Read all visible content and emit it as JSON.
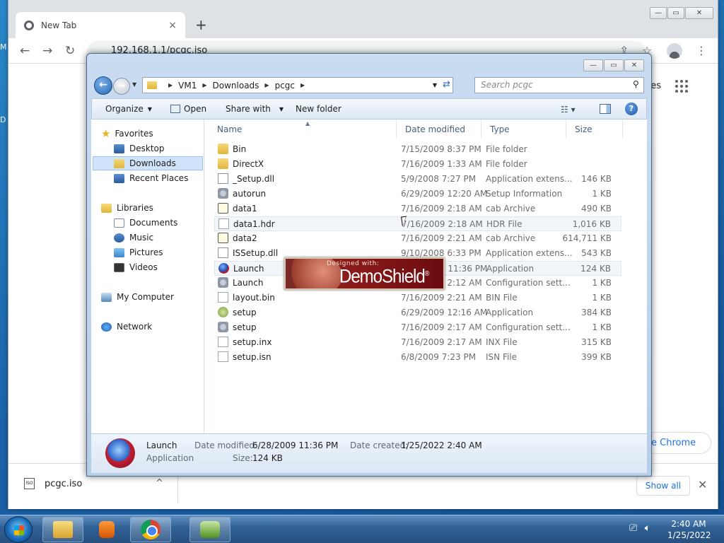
{
  "chrome": {
    "tab_title": "New Tab",
    "tab_close": "×",
    "new_tab": "+",
    "address": "192.168.1.1/pcgc.iso",
    "partial_link": "ges",
    "pill_text": "e Chrome",
    "window_buttons": [
      "—",
      "▭",
      "✕"
    ]
  },
  "download_bar": {
    "file_name": "pcgc.iso",
    "icon_label": "ISO",
    "chevron": "^",
    "show_all": "Show all",
    "close": "✕"
  },
  "desktop_edge": {
    "top": "M",
    "mid": "D"
  },
  "explorer": {
    "window_buttons": [
      "—",
      "▭",
      "✕"
    ],
    "breadcrumb": [
      "VM1",
      "Downloads",
      "pcgc"
    ],
    "search_placeholder": "Search pcgc",
    "toolbar": {
      "organize": "Organize",
      "open": "Open",
      "share_with": "Share with",
      "new_folder": "New folder"
    },
    "nav": {
      "favorites": "Favorites",
      "desktop": "Desktop",
      "downloads": "Downloads",
      "recent_places": "Recent Places",
      "libraries": "Libraries",
      "documents": "Documents",
      "music": "Music",
      "pictures": "Pictures",
      "videos": "Videos",
      "my_computer": "My Computer",
      "network": "Network"
    },
    "columns": {
      "name": "Name",
      "date": "Date modified",
      "type": "Type",
      "size": "Size"
    },
    "files": [
      {
        "name": "Bin",
        "date": "7/15/2009 8:37 PM",
        "type": "File folder",
        "size": "",
        "icon": "folder-icon"
      },
      {
        "name": "DirectX",
        "date": "7/16/2009 1:33 AM",
        "type": "File folder",
        "size": "",
        "icon": "folder-icon"
      },
      {
        "name": "_Setup.dll",
        "date": "5/9/2008 7:27 PM",
        "type": "Application extens...",
        "size": "146 KB",
        "icon": "dll-icon"
      },
      {
        "name": "autorun",
        "date": "6/29/2009 12:20 AM",
        "type": "Setup Information",
        "size": "1 KB",
        "icon": "settings-file-icon"
      },
      {
        "name": "data1",
        "date": "7/16/2009 2:18 AM",
        "type": "cab Archive",
        "size": "490 KB",
        "icon": "cab-icon"
      },
      {
        "name": "data1.hdr",
        "date": "7/16/2009 2:18 AM",
        "type": "HDR File",
        "size": "1,016 KB",
        "icon": "file-icon"
      },
      {
        "name": "data2",
        "date": "7/16/2009 2:21 AM",
        "type": "cab Archive",
        "size": "614,711 KB",
        "icon": "cab-icon"
      },
      {
        "name": "ISSetup.dll",
        "date": "9/10/2008 6:33 PM",
        "type": "Application extens...",
        "size": "543 KB",
        "icon": "dll-icon"
      },
      {
        "name": "Launch",
        "date": "6/28/2009 11:36 PM",
        "type": "Application",
        "size": "124 KB",
        "icon": "launch-app-icon"
      },
      {
        "name": "Launch",
        "date": "7/16/2009 2:12 AM",
        "type": "Configuration sett...",
        "size": "1 KB",
        "icon": "settings-file-icon"
      },
      {
        "name": "layout.bin",
        "date": "7/16/2009 2:21 AM",
        "type": "BIN File",
        "size": "1 KB",
        "icon": "file-icon"
      },
      {
        "name": "setup",
        "date": "6/29/2009 12:16 AM",
        "type": "Application",
        "size": "384 KB",
        "icon": "setup-app-icon"
      },
      {
        "name": "setup",
        "date": "7/16/2009 2:17 AM",
        "type": "Configuration sett...",
        "size": "1 KB",
        "icon": "settings-file-icon"
      },
      {
        "name": "setup.inx",
        "date": "7/16/2009 2:17 AM",
        "type": "INX File",
        "size": "315 KB",
        "icon": "file-icon"
      },
      {
        "name": "setup.isn",
        "date": "6/8/2009 7:23 PM",
        "type": "ISN File",
        "size": "399 KB",
        "icon": "file-icon"
      }
    ],
    "details": {
      "name": "Launch",
      "type": "Application",
      "date_modified_label": "Date modified:",
      "date_modified": "6/28/2009 11:36 PM",
      "size_label": "Size:",
      "size": "124 KB",
      "date_created_label": "Date created:",
      "date_created": "1/25/2022 2:40 AM"
    }
  },
  "splash": {
    "designed_with": "Designed with:",
    "brand": "DemoShield",
    "trademark": "®"
  },
  "taskbar": {
    "time": "2:40 AM",
    "date": "1/25/2022"
  }
}
